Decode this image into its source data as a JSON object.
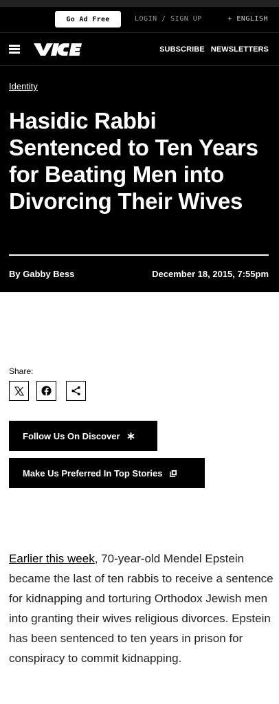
{
  "topbar": {
    "ad_free_label": "Go Ad Free",
    "login_label": "LOGIN / SIGN UP",
    "language_label": "+ ENGLISH"
  },
  "nav": {
    "logo_text": "VICE",
    "menu_icon": "hamburger-icon",
    "subscribe_label": "SUBSCRIBE",
    "newsletters_label": "NEWSLETTERS"
  },
  "article_header": {
    "category": "Identity",
    "headline": "Hasidic Rabbi Sentenced to Ten Years for Beating Men into Divorcing Their Wives",
    "byline": "By Gabby Bess",
    "date": "December 18, 2015, 7:55pm"
  },
  "share": {
    "label": "Share:",
    "buttons": [
      "x-icon",
      "facebook-icon",
      "share-icon"
    ]
  },
  "cta": {
    "discover_label": "Follow Us On Discover",
    "discover_icon": "asterisk-icon",
    "preferred_label": "Make Us Preferred In Top Stories",
    "preferred_icon": "stories-icon"
  },
  "body": {
    "link_text": "Earlier this week",
    "paragraph_rest": ", 70-year-old Mendel Epstein became the last of ten rabbis to receive a sentence for kidnapping and torturing Orthodox Jewish men into granting their wives religious divorces. Epstein has been sentenced to ten years in prison for conspiracy to commit kidnapping."
  },
  "colors": {
    "header_bg": "#000000",
    "page_bg": "#ffffff",
    "text": "#222222",
    "muted": "#9a9a9a"
  }
}
